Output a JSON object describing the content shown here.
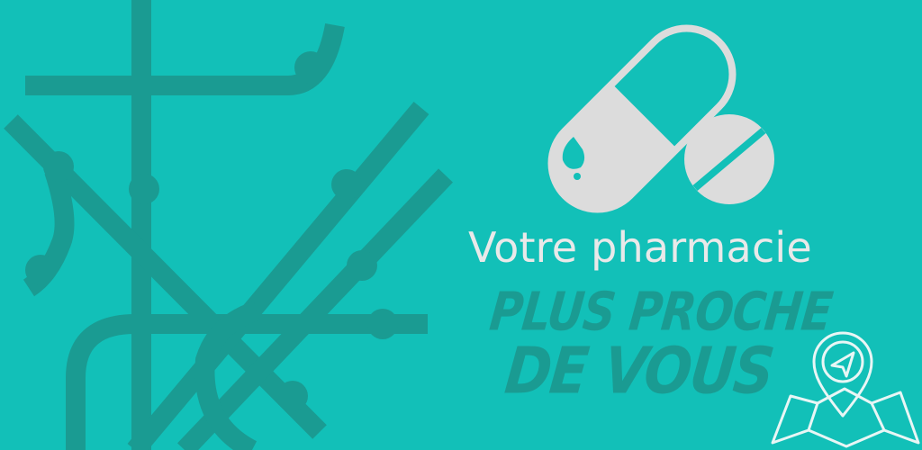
{
  "banner": {
    "headline": "Votre pharmacie",
    "tagline_line1": "PLUS PROCHE",
    "tagline_line2": "DE VOUS"
  },
  "colors": {
    "background": "#12c0b8",
    "metro_lines": "#1a9b92",
    "headline": "#e9e9e9",
    "tagline": "#1a9b92",
    "pill_fill": "#dcdcdc"
  },
  "icons": [
    "metro-map-icon",
    "capsule-pill-icon",
    "tablet-pill-icon",
    "map-location-pin-icon"
  ]
}
